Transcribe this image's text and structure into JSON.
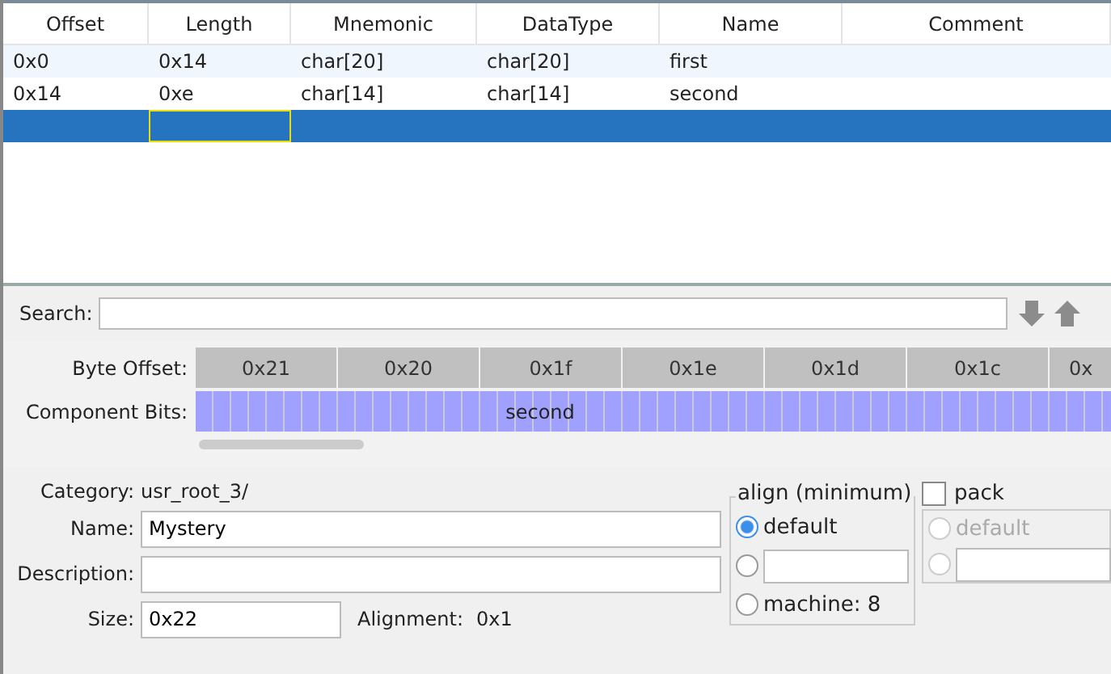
{
  "table": {
    "columns": [
      "Offset",
      "Length",
      "Mnemonic",
      "DataType",
      "Name",
      "Comment"
    ],
    "rows": [
      {
        "selected": false,
        "cells": [
          "0x0",
          "0x14",
          "char[20]",
          "char[20]",
          "first"
        ],
        "focused_cells": [
          false,
          false,
          false,
          false,
          false,
          false
        ]
      },
      {
        "selected": false,
        "cells": [
          "0x14",
          "0xe",
          "char[14]",
          "char[14]",
          "second"
        ],
        "focused_cells": [
          false,
          false,
          false,
          false,
          false,
          false
        ]
      },
      {
        "selected": true,
        "focused_cells": [
          false,
          true,
          false,
          false,
          false,
          false
        ]
      }
    ]
  },
  "search": {
    "label": "Search:"
  },
  "bit_view": {
    "byte_offset_label": "Byte Offset:",
    "component_bits_label": "Component Bits:",
    "byte_offsets": [
      "0x21",
      "0x20",
      "0x1f",
      "0x1e",
      "0x1d",
      "0x1c",
      "0x"
    ],
    "component": "second"
  },
  "form": {
    "category_label": "Category:",
    "category": "usr_root_3/",
    "name_label": "Name:",
    "name": "Mystery",
    "description_label": "Description:",
    "size_label": "Size:",
    "size": "0x22",
    "alignment_label": "Alignment:",
    "alignment": "0x1"
  },
  "align": {
    "title": "align (minimum)",
    "options": [
      {
        "kind": "label",
        "label": "default",
        "selected": true
      },
      {
        "kind": "field",
        "selected": false
      },
      {
        "kind": "label",
        "label": "machine: 8",
        "selected": false
      }
    ]
  },
  "pack": {
    "label": "pack",
    "checked": false,
    "disabled": true,
    "options": [
      {
        "kind": "label",
        "label": "default",
        "selected": false
      },
      {
        "kind": "field",
        "selected": false
      }
    ]
  }
}
